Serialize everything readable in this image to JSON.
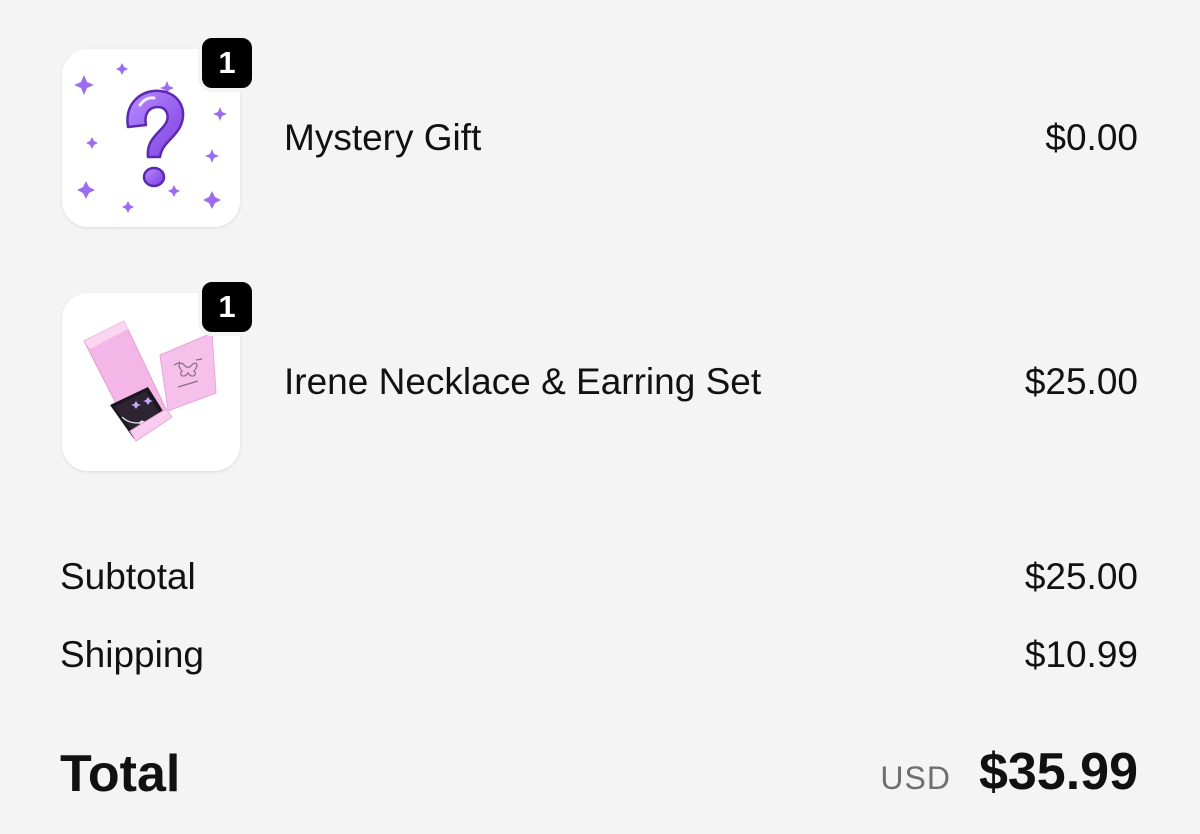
{
  "items": [
    {
      "name": "Mystery Gift",
      "price": "$0.00",
      "quantity": "1",
      "image_icon": "mystery-question-mark-icon"
    },
    {
      "name": "Irene Necklace & Earring Set",
      "price": "$25.00",
      "quantity": "1",
      "image_icon": "jewelry-box-icon"
    }
  ],
  "summary": {
    "subtotal_label": "Subtotal",
    "subtotal_value": "$25.00",
    "shipping_label": "Shipping",
    "shipping_value": "$10.99"
  },
  "total": {
    "label": "Total",
    "currency": "USD",
    "value": "$35.99"
  },
  "colors": {
    "background": "#f4f4f4",
    "badge": "#000000",
    "accent_purple": "#9b5cf0",
    "box_pink": "#f7c6ec"
  }
}
